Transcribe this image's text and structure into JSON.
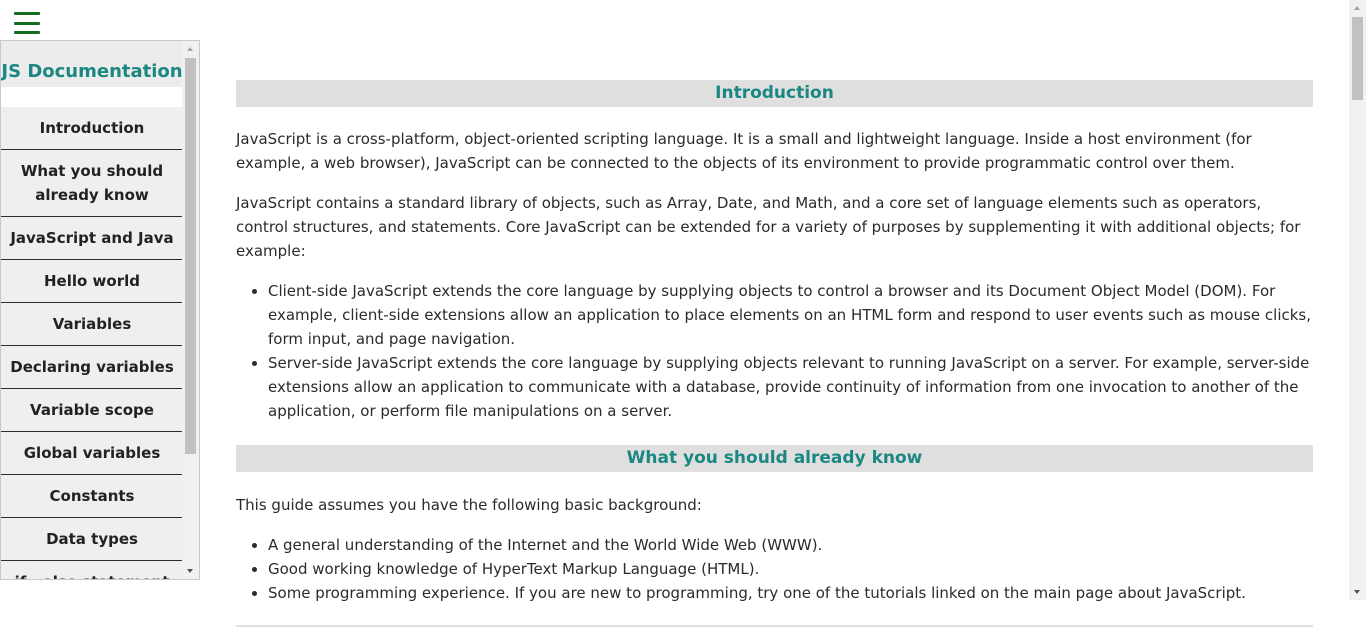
{
  "sidebar": {
    "title": "JS Documentation",
    "items": [
      {
        "label": "Introduction"
      },
      {
        "label": "What you should already know"
      },
      {
        "label": "JavaScript and Java"
      },
      {
        "label": "Hello world"
      },
      {
        "label": "Variables"
      },
      {
        "label": "Declaring variables"
      },
      {
        "label": "Variable scope"
      },
      {
        "label": "Global variables"
      },
      {
        "label": "Constants"
      },
      {
        "label": "Data types"
      },
      {
        "label": "if...else statement"
      }
    ]
  },
  "main": {
    "sections": [
      {
        "heading": "Introduction",
        "paragraphs": [
          "JavaScript is a cross-platform, object-oriented scripting language. It is a small and lightweight language. Inside a host environment (for example, a web browser), JavaScript can be connected to the objects of its environment to provide programmatic control over them.",
          "JavaScript contains a standard library of objects, such as Array, Date, and Math, and a core set of language elements such as operators, control structures, and statements. Core JavaScript can be extended for a variety of purposes by supplementing it with additional objects; for example:"
        ],
        "list": [
          "Client-side JavaScript extends the core language by supplying objects to control a browser and its Document Object Model (DOM). For example, client-side extensions allow an application to place elements on an HTML form and respond to user events such as mouse clicks, form input, and page navigation.",
          "Server-side JavaScript extends the core language by supplying objects relevant to running JavaScript on a server. For example, server-side extensions allow an application to communicate with a database, provide continuity of information from one invocation to another of the application, or perform file manipulations on a server."
        ]
      },
      {
        "heading": "What you should already know",
        "paragraphs": [
          "This guide assumes you have the following basic background:"
        ],
        "list": [
          "A general understanding of the Internet and the World Wide Web (WWW).",
          "Good working knowledge of HyperText Markup Language (HTML).",
          "Some programming experience. If you are new to programming, try one of the tutorials linked on the main page about JavaScript."
        ]
      }
    ]
  },
  "icons": {
    "menu": "hamburger-menu-icon"
  },
  "colors": {
    "accent": "#1a8782",
    "menu_icon": "#176b1f",
    "header_bg": "#dfdfdf",
    "nav_bg": "#efefef"
  }
}
